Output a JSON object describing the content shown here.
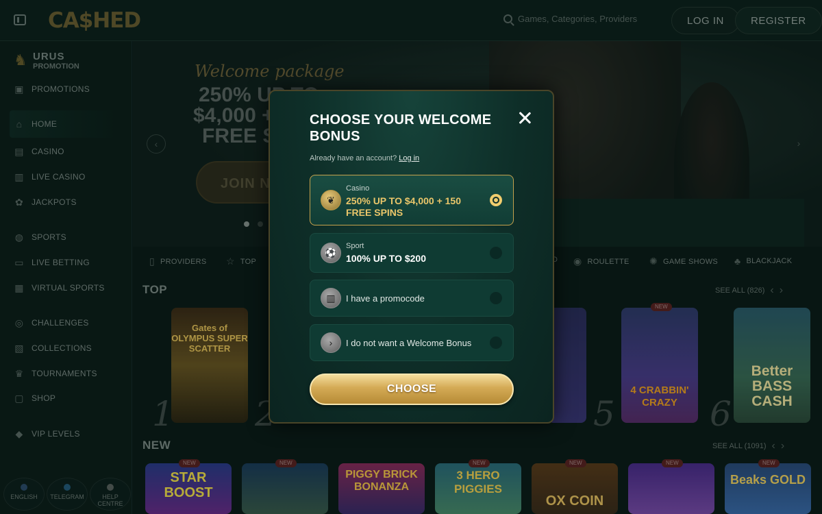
{
  "header": {
    "logo": "CA$HED",
    "search_placeholder": "Games, Categories, Providers",
    "login_label": "LOG IN",
    "register_label": "REGISTER"
  },
  "sidebar": {
    "promo_title": "URUS",
    "promo_sub": "PROMOTION",
    "items": [
      {
        "label": "PROMOTIONS",
        "icon": "gift-icon"
      },
      {
        "label": "HOME",
        "icon": "home-icon"
      },
      {
        "label": "CASINO",
        "icon": "slot-machine-icon"
      },
      {
        "label": "LIVE CASINO",
        "icon": "live-casino-icon"
      },
      {
        "label": "JACKPOTS",
        "icon": "jackpot-icon"
      },
      {
        "label": "SPORTS",
        "icon": "ball-icon"
      },
      {
        "label": "LIVE BETTING",
        "icon": "live-icon"
      },
      {
        "label": "VIRTUAL SPORTS",
        "icon": "virtual-icon"
      },
      {
        "label": "CHALLENGES",
        "icon": "challenge-icon"
      },
      {
        "label": "COLLECTIONS",
        "icon": "collection-icon"
      },
      {
        "label": "TOURNAMENTS",
        "icon": "trophy-icon"
      },
      {
        "label": "SHOP",
        "icon": "shop-icon"
      },
      {
        "label": "VIP LEVELS",
        "icon": "diamond-icon"
      }
    ],
    "footer": {
      "english": "ENGLISH",
      "telegram": "TELEGRAM",
      "help": "HELP CENTRE"
    }
  },
  "hero": {
    "script": "Welcome package",
    "line1": "250% UP TO",
    "line2": "$4,000 +",
    "line3": "FREE S",
    "join_label": "JOIN N"
  },
  "categories": [
    {
      "label": "PROVIDERS"
    },
    {
      "label": "TOP"
    },
    {
      "label": "D"
    },
    {
      "label": "ROULETTE"
    },
    {
      "label": "GAME SHOWS"
    },
    {
      "label": "BLACKJACK"
    }
  ],
  "top_section": {
    "title": "TOP",
    "see_all": "SEE ALL (826)"
  },
  "new_section": {
    "title": "NEW",
    "see_all": "SEE ALL (1091)"
  },
  "top_games": [
    {
      "rank": "1",
      "title": "Gates of OLYMPUS SUPER SCATTER"
    },
    {
      "rank": "2",
      "title": ""
    },
    {
      "rank": "5",
      "title": "4 CRABBIN' CRAZY",
      "badge": "NEW"
    },
    {
      "rank": "6",
      "title": "Better BASS CASH"
    }
  ],
  "new_games": [
    {
      "title": "STAR BOOST",
      "badge": "NEW"
    },
    {
      "title": "",
      "badge": "NEW"
    },
    {
      "title": "PIGGY BRICK BONANZA",
      "badge": ""
    },
    {
      "title": "3 HERO PIGGIES",
      "badge": "NEW"
    },
    {
      "title": "OX COIN",
      "badge": "NEW"
    },
    {
      "title": "",
      "badge": "NEW"
    },
    {
      "title": "Beaks GOLD",
      "badge": "NEW"
    }
  ],
  "modal": {
    "title": "CHOOSE YOUR WELCOME BONUS",
    "account_text": "Already have an account?",
    "login_link": "Log in",
    "options": [
      {
        "label": "Casino",
        "value": "250% UP TO $4,000 + 150 FREE SPINS",
        "selected": true
      },
      {
        "label": "Sport",
        "value": "100% UP TO $200",
        "selected": false
      },
      {
        "label": "",
        "value": "I have a promocode",
        "selected": false
      },
      {
        "label": "",
        "value": "I do not want a Welcome Bonus",
        "selected": false
      }
    ],
    "choose_label": "CHOOSE"
  },
  "colors": {
    "accent_gold": "#d4aa55",
    "modal_bg": "#0e2e28"
  }
}
